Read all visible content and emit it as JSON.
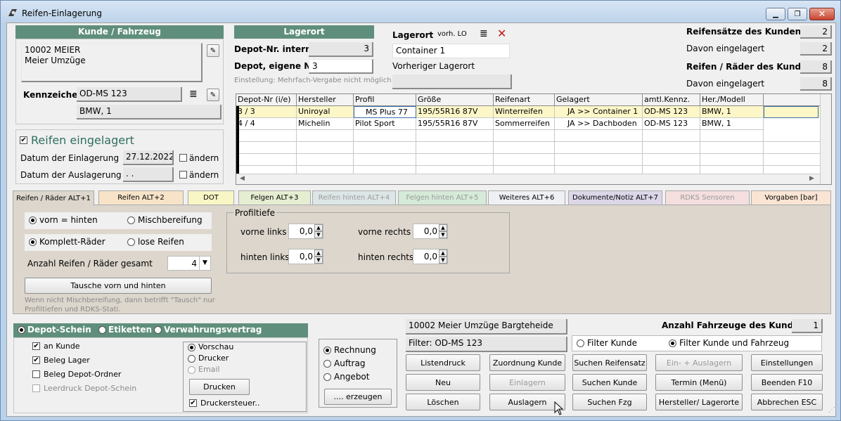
{
  "window": {
    "title": "Reifen-Einlagerung"
  },
  "kunde": {
    "header": "Kunde / Fahrzeug",
    "name_line1": "10002 MEIER",
    "name_line2": "Meier Umzüge",
    "kennzeichen_label": "Kennzeichen",
    "kennzeichen": "OD-MS 123",
    "fahrzeug": "BMW, 1"
  },
  "eingelagert": {
    "label": "Reifen eingelagert",
    "datum_ein_label": "Datum der Einlagerung",
    "datum_ein": "27.12.2022",
    "datum_aus_label": "Datum der Auslagerung",
    "datum_aus": ". .",
    "aendern1": "ändern",
    "aendern2": "ändern"
  },
  "lagerort": {
    "header": "Lagerort",
    "depot_intern_label": "Depot-Nr. intern",
    "depot_intern": "3",
    "depot_eigen_label": "Depot, eigene Nr.",
    "depot_eigen": "3",
    "hinweis": "Einstellung: Mehrfach-Vergabe nicht möglich",
    "lagerort_label": "Lagerort",
    "vorh_lo": "vorh. LO",
    "lagerort_value": "Container 1",
    "vorheriger_label": "Vorheriger Lagerort",
    "vorheriger_value": ""
  },
  "stats": {
    "reifensaetze_label": "Reifensätze des Kunden",
    "reifensaetze": "2",
    "davon1_label": "Davon eingelagert",
    "davon1": "2",
    "reifen_raeder_label": "Reifen / Räder des Kunden",
    "reifen_raeder": "8",
    "davon2_label": "Davon eingelagert",
    "davon2": "8"
  },
  "grid": {
    "columns": [
      "Depot-Nr (i/e)",
      "Hersteller",
      "Profil",
      "Größe",
      "Reifenart",
      "Gelagert",
      "amtl.Kennz.",
      "Her./Modell"
    ],
    "rows": [
      [
        "3 / 3",
        "Uniroyal",
        "MS Plus 77",
        "195/55R16 87V",
        "Winterreifen",
        "JA >> Container 1",
        "OD-MS 123",
        "BMW, 1"
      ],
      [
        "4 / 4",
        "Michelin",
        "Pilot Sport",
        "195/55R16 87V",
        "Sommerreifen",
        "JA >> Dachboden",
        "OD-MS 123",
        "BMW, 1"
      ]
    ]
  },
  "tabs": [
    "Reifen / Räder ALT+1",
    "Reifen ALT+2",
    "DOT",
    "Felgen ALT+3",
    "Reifen hinten ALT+4",
    "Felgen hinten ALT+5",
    "Weiteres ALT+6",
    "Dokumente/Notiz ALT+7",
    "RDKS Sensoren",
    "Vorgaben [bar]"
  ],
  "tabcolors": [
    "#dcd6cc",
    "#f7e3c8",
    "#f8f6c5",
    "#e6eed2",
    "#dde6e6",
    "#d5ead8",
    "#eef0f4",
    "#dcd6e8",
    "#f4dede",
    "#fae4d4"
  ],
  "panel": {
    "vorn_hinten": "vorn = hinten",
    "misch": "Mischbereifung",
    "komplett": "Komplett-Räder",
    "lose": "lose Reifen",
    "anzahl_label": "Anzahl Reifen / Räder gesamt",
    "anzahl": "4",
    "tausche": "Tausche vorn und hinten",
    "hinweis": "Wenn nicht Mischbereifung, dann betrifft \"Tausch\" nur Profiltiefen und RDKS-Stati.",
    "profiltiefe": "Profiltiefe",
    "vl_label": "vorne links",
    "vl": "0,0",
    "vr_label": "vorne rechts",
    "vr": "0,0",
    "hl_label": "hinten links",
    "hl": "0,0",
    "hr_label": "hinten rechts",
    "hr": "0,0"
  },
  "print": {
    "depot_schein": "Depot-Schein",
    "etiketten": "Etiketten",
    "verwahrung": "Verwahrungsvertrag",
    "an_kunde": "an Kunde",
    "beleg_lager": "Beleg Lager",
    "beleg_depot": "Beleg Depot-Ordner",
    "leerdruck": "Leerdruck Depot-Schein",
    "vorschau": "Vorschau",
    "drucker": "Drucker",
    "email": "Email",
    "drucken": "Drucken",
    "druckersteuer": "Druckersteuer.."
  },
  "beleg": {
    "rechnung": "Rechnung",
    "auftrag": "Auftrag",
    "angebot": "Angebot",
    "erzeugen": ".... erzeugen"
  },
  "info": {
    "kunde": "10002 Meier Umzüge Bargteheide",
    "filter": "Filter: OD-MS 123",
    "anzahl_label": "Anzahl Fahrzeuge des Kunden",
    "anzahl": "1",
    "filter_kunde": "Filter Kunde",
    "filter_kf": "Filter Kunde und Fahrzeug"
  },
  "buttons": {
    "listendruck": "Listendruck",
    "zuordnung": "Zuordnung Kunde",
    "suchen_satz": "Suchen Reifensatz",
    "ein_aus": "Ein- + Auslagern",
    "einstellungen": "Einstellungen",
    "neu": "Neu",
    "einlagern": "Einlagern",
    "suchen_kunde": "Suchen Kunde",
    "termin": "Termin (Menü)",
    "beenden": "Beenden F10",
    "loeschen": "Löschen",
    "auslagern": "Auslagern",
    "suchen_fzg": "Suchen Fzg",
    "hersteller": "Hersteller/ Lagerorte",
    "abbrechen": "Abbrechen ESC"
  }
}
